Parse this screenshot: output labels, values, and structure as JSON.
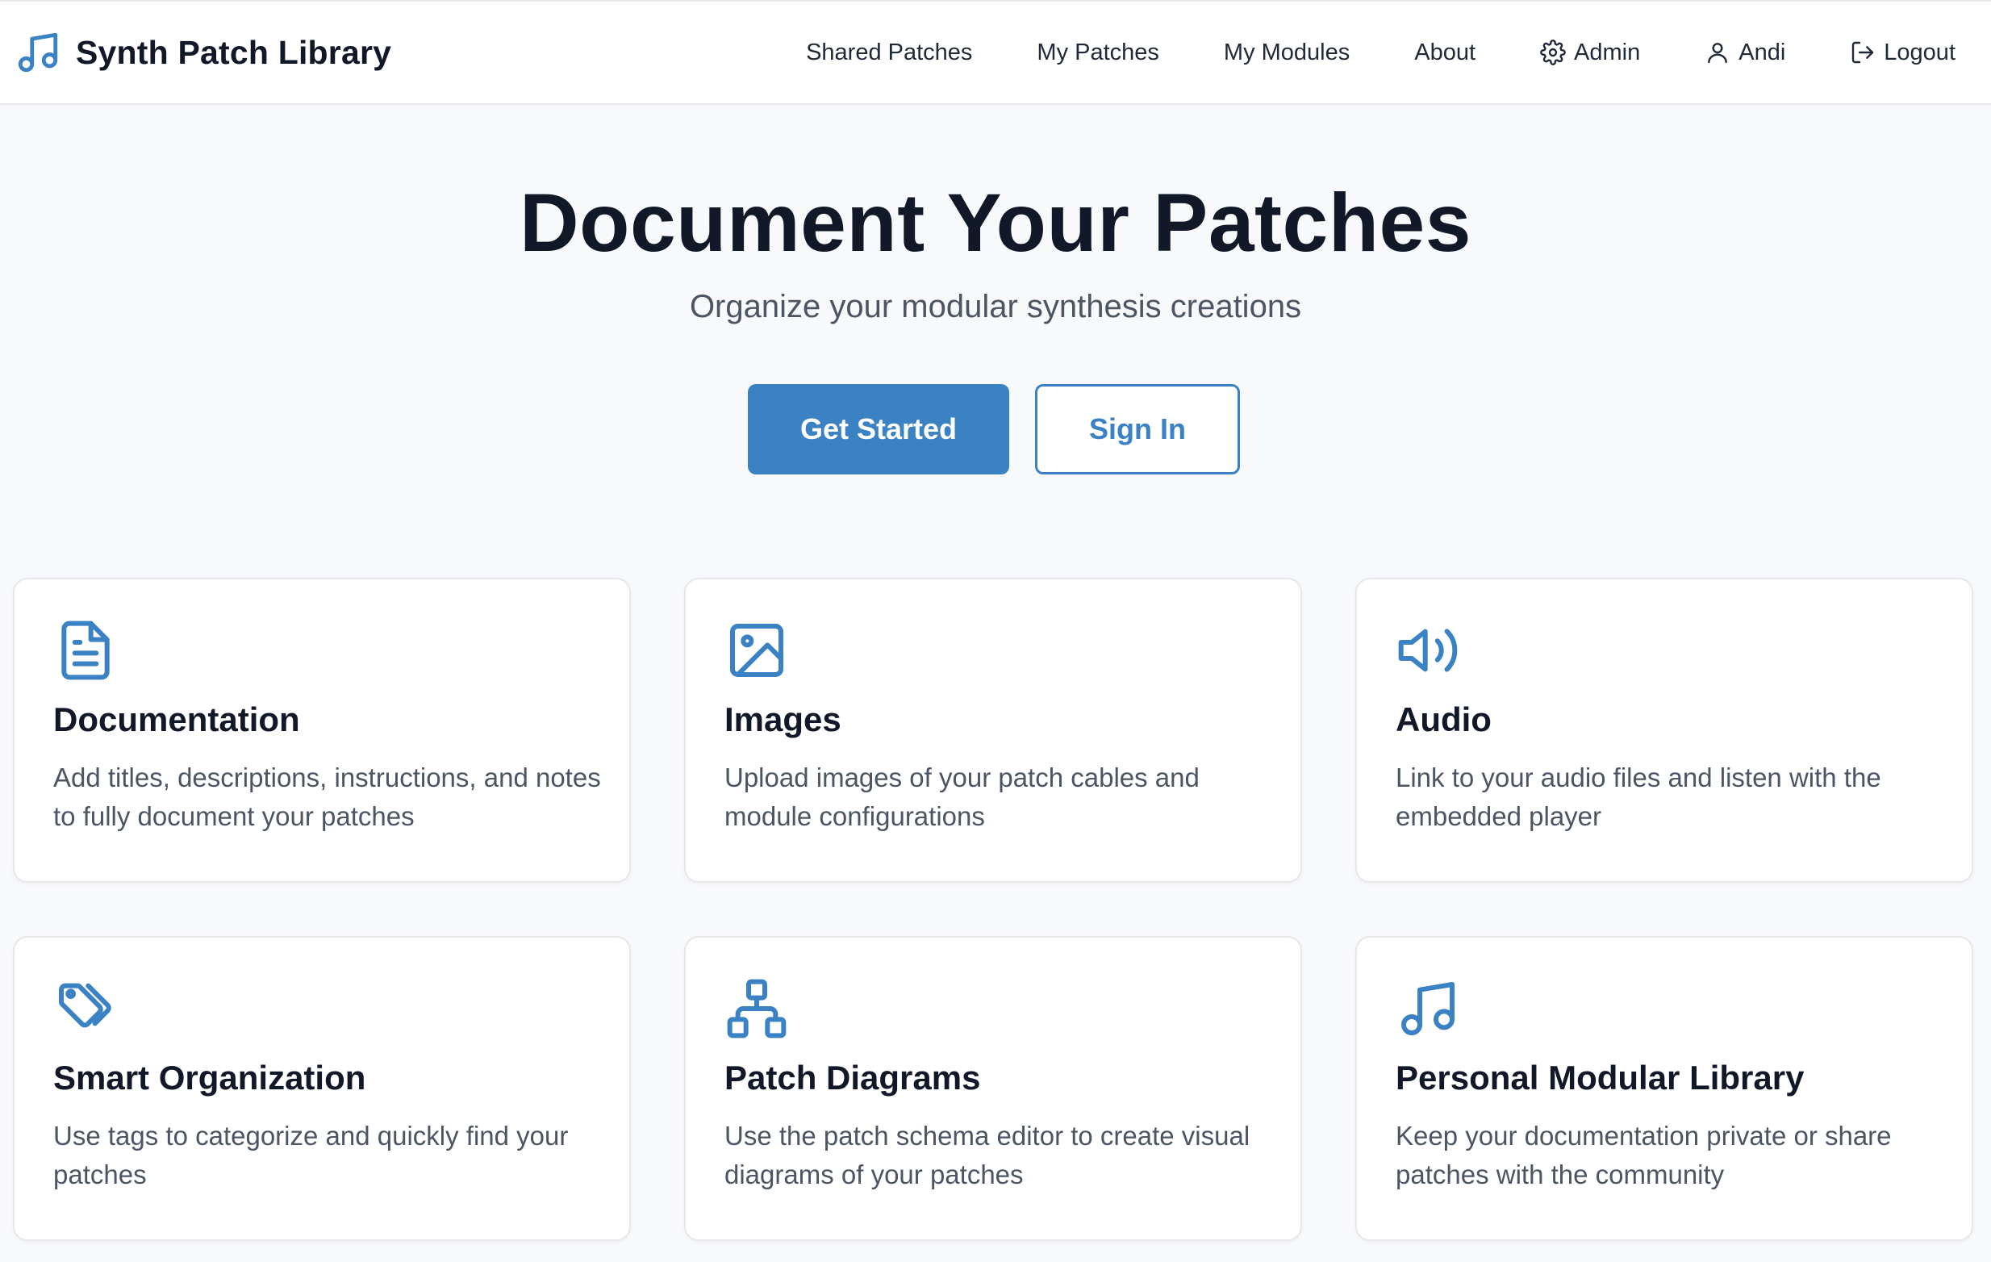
{
  "brand": {
    "title": "Synth Patch Library",
    "icon": "music-note-icon"
  },
  "nav": {
    "shared_patches": "Shared Patches",
    "my_patches": "My Patches",
    "my_modules": "My Modules",
    "about": "About",
    "admin": "Admin",
    "user": "Andi",
    "logout": "Logout"
  },
  "hero": {
    "title": "Document Your Patches",
    "subtitle": "Organize your modular synthesis creations",
    "primary_button": "Get Started",
    "secondary_button": "Sign In"
  },
  "features": [
    {
      "icon": "document-icon",
      "title": "Documentation",
      "text": "Add titles, descriptions, instructions, and notes to fully document your patches"
    },
    {
      "icon": "image-icon",
      "title": "Images",
      "text": "Upload images of your patch cables and module configurations"
    },
    {
      "icon": "speaker-icon",
      "title": "Audio",
      "text": "Link to your audio files and listen with the embedded player"
    },
    {
      "icon": "tags-icon",
      "title": "Smart Organization",
      "text": "Use tags to categorize and quickly find your patches"
    },
    {
      "icon": "diagram-icon",
      "title": "Patch Diagrams",
      "text": "Use the patch schema editor to create visual diagrams of your patches"
    },
    {
      "icon": "music-note-icon",
      "title": "Personal Modular Library",
      "text": "Keep your documentation private or share patches with the community"
    }
  ],
  "colors": {
    "accent": "#3b82c4",
    "text": "#111827",
    "muted": "#4b5563",
    "background": "#f8f9fb"
  }
}
